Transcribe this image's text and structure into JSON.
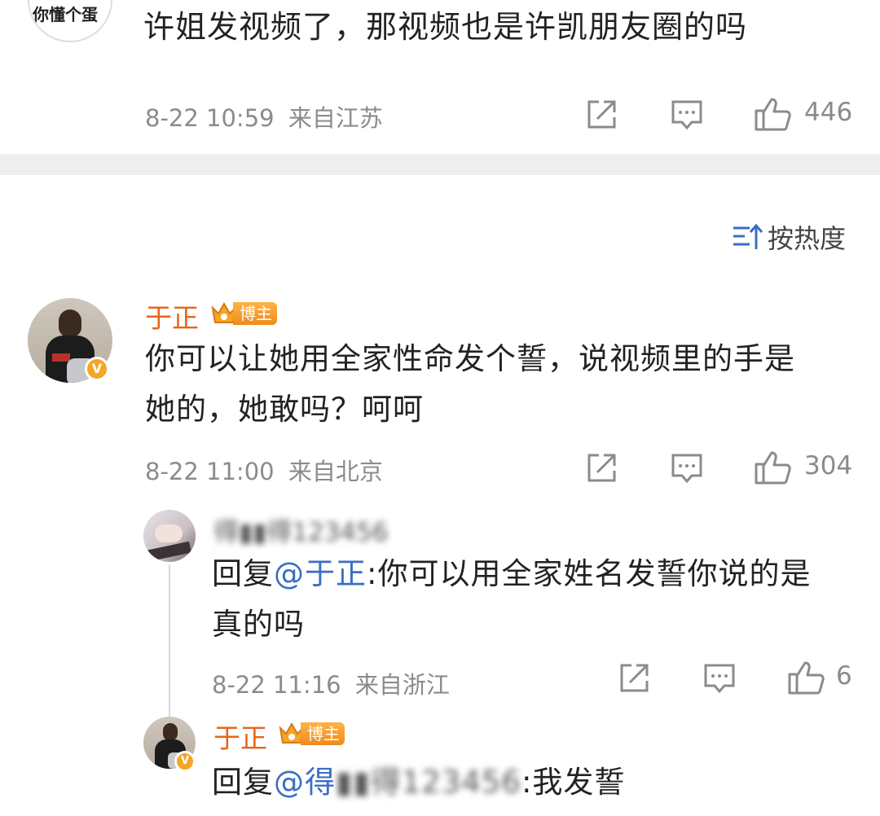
{
  "comment1": {
    "avatar_text": "你懂个蛋",
    "text": "许姐发视频了，那视频也是许凯朋友圈的吗",
    "time": "8-22 10:59",
    "location": "来自江苏",
    "likes": "446"
  },
  "sort": {
    "label": "按热度"
  },
  "comment2": {
    "name": "于正",
    "badge": "博主",
    "text_line1": "你可以让她用全家性命发个誓，说视频里的手是",
    "text_line2": "她的，她敢吗？呵呵",
    "time": "8-22 11:00",
    "location": "来自北京",
    "likes": "304"
  },
  "reply1": {
    "name": "得▮▮得123456",
    "reply_prefix": "回复",
    "mention": "@于正",
    "text_line1": ":你可以用全家姓名发誓你说的是",
    "text_line2": "真的吗",
    "time": "8-22 11:16",
    "location": "来自浙江",
    "likes": "6"
  },
  "reply2": {
    "name": "于正",
    "badge": "博主",
    "reply_prefix": "回复",
    "mention": "@得",
    "blurred": "▮▮得123456",
    "text_end": ":我发誓"
  },
  "colors": {
    "accent_name": "#e8651a",
    "mention": "#3a6ec5",
    "meta": "#8b8b8b",
    "divider": "#eeeeee"
  }
}
